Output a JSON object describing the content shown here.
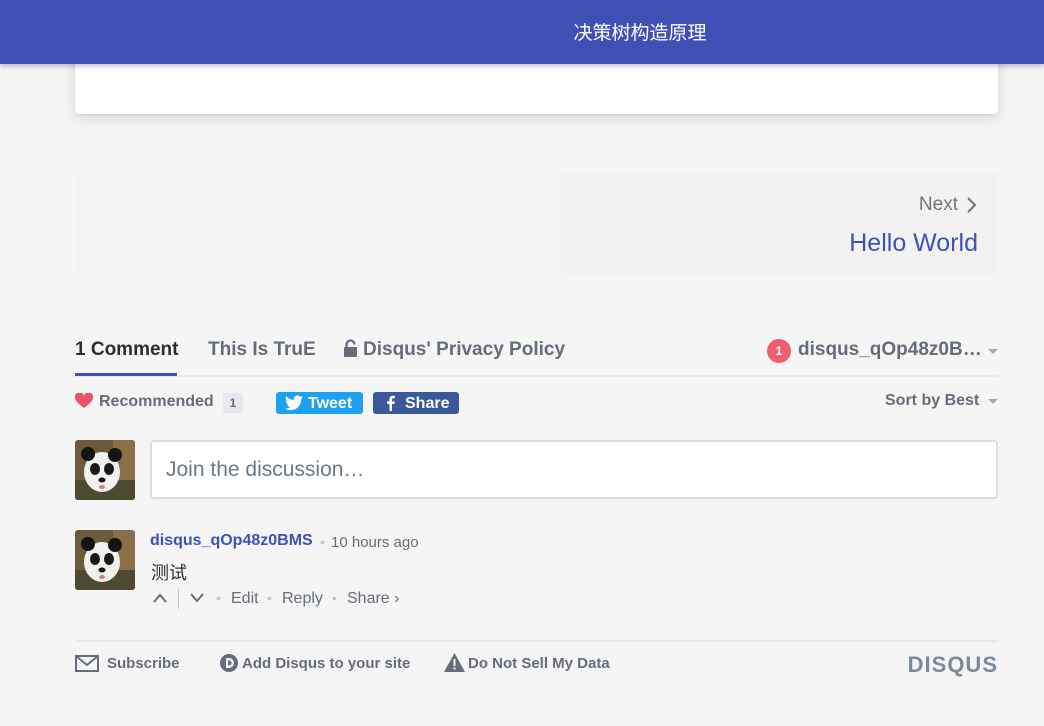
{
  "header": {
    "title": "决策树构造原理"
  },
  "post_nav": {
    "next_label": "Next",
    "next_title": "Hello World"
  },
  "tabs": {
    "comments": "1 Comment",
    "community": "This Is TruE",
    "privacy": "Disqus' Privacy Policy",
    "user_badge_count": "1",
    "user_name": "disqus_qOp48z0B…"
  },
  "toolbar": {
    "recommended_label": "Recommended",
    "recommended_count": "1",
    "tweet_label": "Tweet",
    "share_label": "Share",
    "sort_label": "Sort by Best"
  },
  "compose": {
    "placeholder": "Join the discussion…"
  },
  "comment": {
    "author": "disqus_qOp48z0BMS",
    "separator": "•",
    "time": "10 hours ago",
    "body": "测试",
    "edit": "Edit",
    "reply": "Reply",
    "share": "Share ›"
  },
  "footer": {
    "subscribe": "Subscribe",
    "add_disqus": "Add Disqus to your site",
    "do_not_sell": "Do Not Sell My Data",
    "brand": "DISQUS"
  },
  "colors": {
    "primary": "#3f51b5",
    "badge": "#f05f70",
    "tweet": "#1da1f2",
    "facebook": "#3b5998",
    "heart": "#e8546a"
  },
  "icons": [
    "chevron-right-icon",
    "lock-icon",
    "heart-icon",
    "twitter-icon",
    "facebook-icon",
    "upvote-icon",
    "downvote-icon",
    "envelope-icon",
    "disqus-d-icon",
    "warning-icon",
    "panda-avatar"
  ]
}
